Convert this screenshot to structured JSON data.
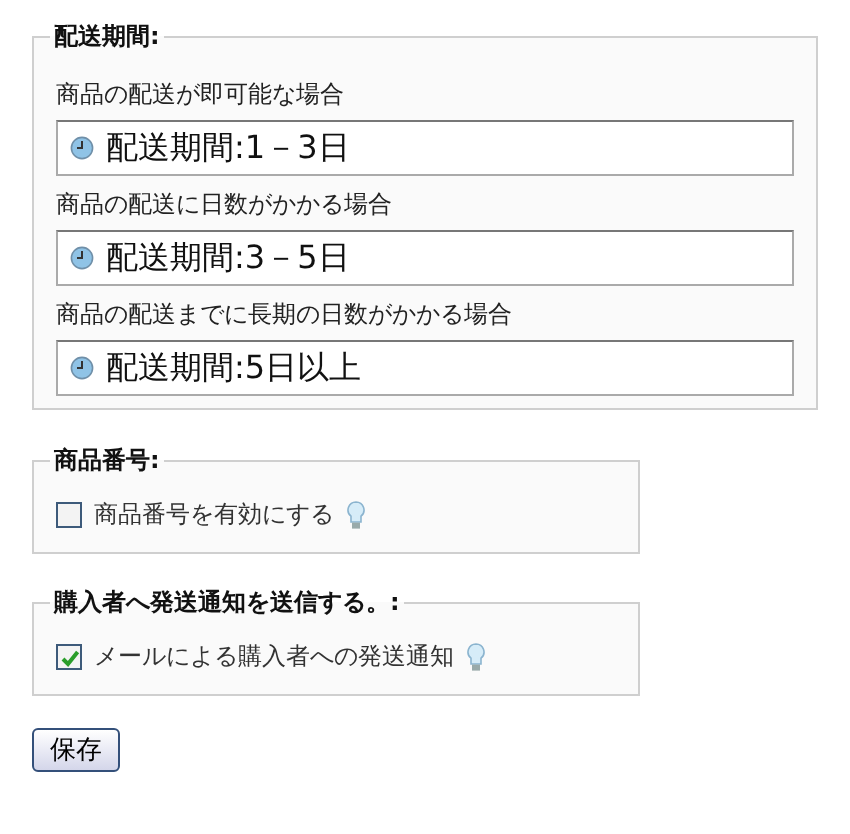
{
  "delivery": {
    "legend": "配送期間:",
    "options": [
      {
        "label": "商品の配送が即可能な場合",
        "value": "配送期間:1－3日"
      },
      {
        "label": "商品の配送に日数がかかる場合",
        "value": "配送期間:3－5日"
      },
      {
        "label": "商品の配送までに長期の日数がかかる場合",
        "value": "配送期間:5日以上"
      }
    ]
  },
  "sections": [
    {
      "legend": "商品番号:",
      "label": "商品番号を有効にする",
      "checked": false
    },
    {
      "legend": "購入者へ発送通知を送信する。:",
      "label": "メールによる購入者への発送通知",
      "checked": true
    }
  ],
  "save_button": "保存"
}
